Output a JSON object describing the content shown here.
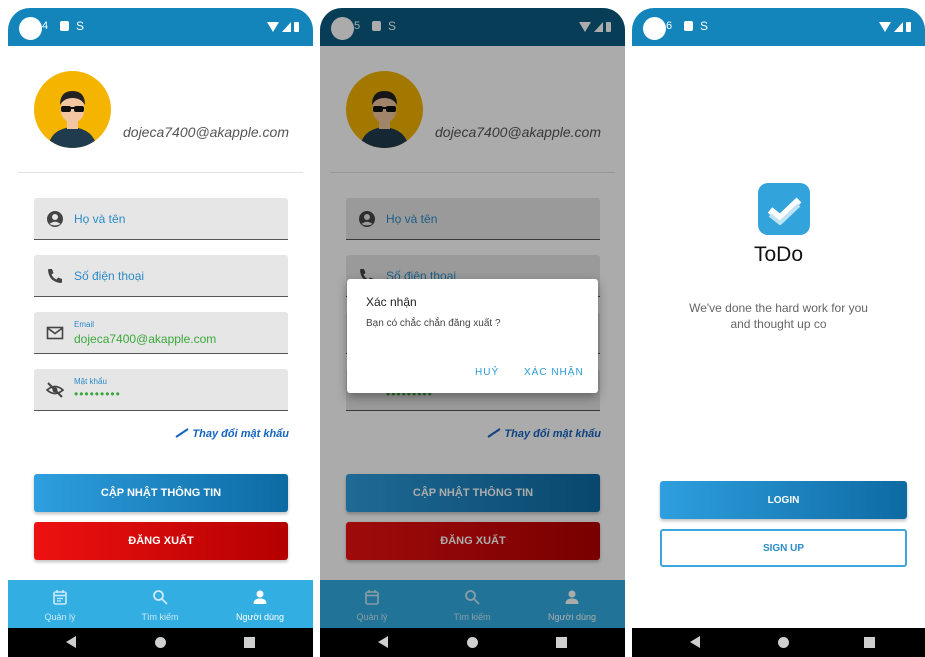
{
  "colors": {
    "primary": "#1385bb",
    "nav": "#32aee3",
    "accent_red": "#e00000",
    "link_blue": "#1565c0",
    "value_green": "#3aa83a"
  },
  "screens": [
    {
      "status_time": "4",
      "profile": {
        "email": "dojeca7400@akapple.com"
      },
      "fields": {
        "name_label": "Họ và tên",
        "phone_label": "Số điện thoại",
        "email_label": "Email",
        "email_value": "dojeca7400@akapple.com",
        "password_label": "Mật khẩu",
        "password_value": "•••••••••"
      },
      "change_password": "Thay đổi mật khẩu",
      "update_button": "CẬP NHẬT THÔNG TIN",
      "logout_button": "ĐĂNG XUẤT",
      "nav": [
        {
          "label": "Quản lý",
          "icon": "calendar-icon"
        },
        {
          "label": "Tìm kiếm",
          "icon": "search-icon"
        },
        {
          "label": "Người dùng",
          "icon": "person-icon"
        }
      ]
    },
    {
      "status_time": "5",
      "profile": {
        "email": "dojeca7400@akapple.com"
      },
      "fields": {
        "name_label": "Họ và tên",
        "phone_label": "Số điện thoại",
        "password_value": "•••••••••"
      },
      "change_password": "Thay đổi mật khẩu",
      "update_button": "CẬP NHẬT THÔNG TIN",
      "logout_button": "ĐĂNG XUẤT",
      "dialog": {
        "title": "Xác nhận",
        "message": "Bạn có chắc chắn đăng xuất ?",
        "cancel": "HUỶ",
        "confirm": "XÁC NHẬN"
      },
      "nav": [
        {
          "label": "Quản lý",
          "icon": "calendar-icon"
        },
        {
          "label": "Tìm kiếm",
          "icon": "search-icon"
        },
        {
          "label": "Người dùng",
          "icon": "person-icon"
        }
      ]
    },
    {
      "status_time": "6",
      "app_name": "ToDo",
      "tagline_line1": "We've done the hard work for you",
      "tagline_line2": "and thought up co",
      "login_button": "LOGIN",
      "signup_button": "SIGN UP"
    }
  ]
}
